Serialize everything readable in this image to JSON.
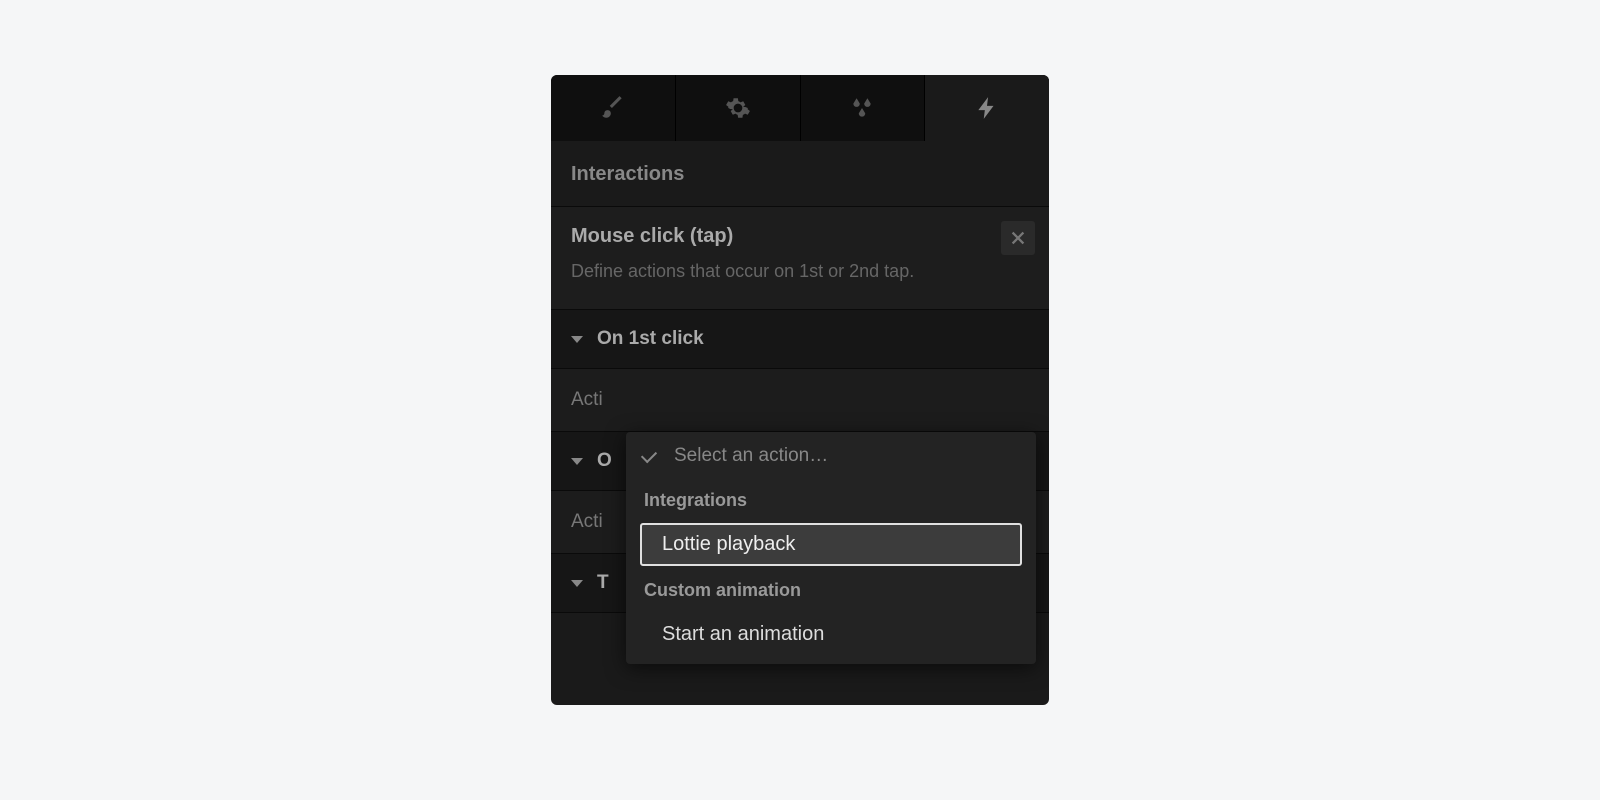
{
  "section_title": "Interactions",
  "trigger": {
    "title": "Mouse click (tap)",
    "desc": "Define actions that occur on 1st or 2nd tap."
  },
  "rows": {
    "first_click": "On 1st click",
    "second_row_visible": "O",
    "third_row_visible": "T"
  },
  "action_label": "Acti",
  "action_label2": "Acti",
  "dropdown": {
    "placeholder": "Select an action…",
    "group1": "Integrations",
    "opt1": "Lottie playback",
    "group2": "Custom animation",
    "opt2": "Start an animation"
  }
}
